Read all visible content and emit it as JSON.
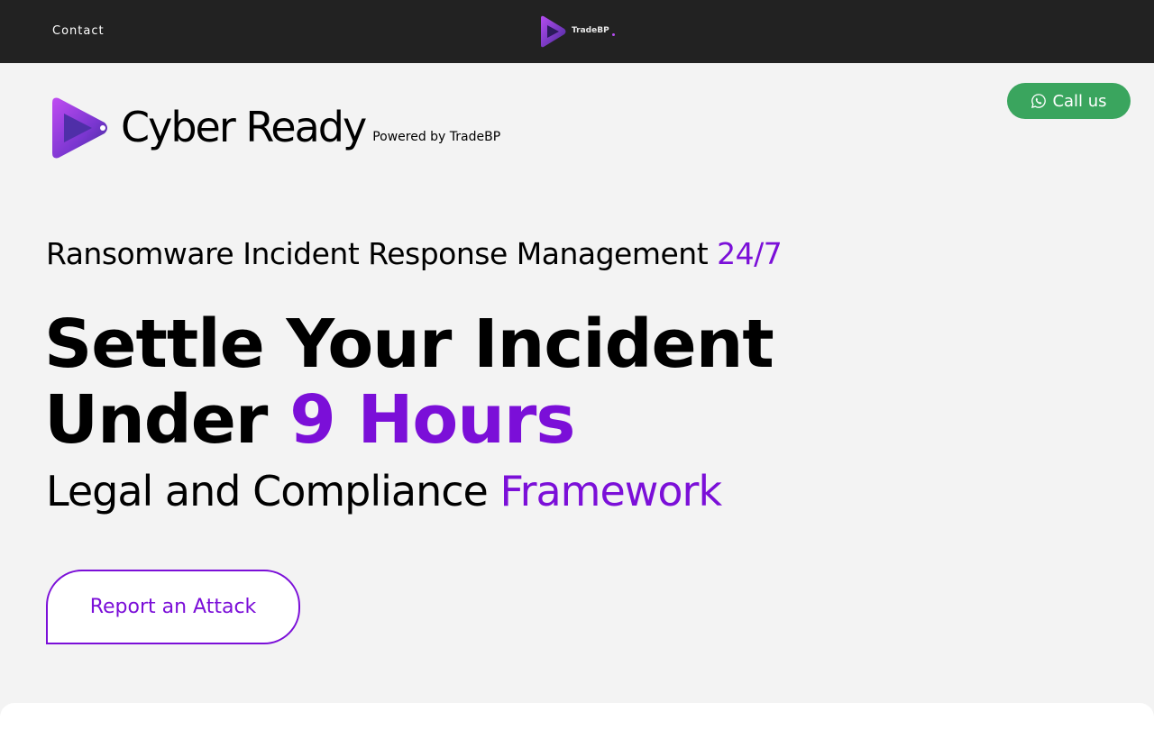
{
  "nav": {
    "contact_label": "Contact",
    "logo_text": "TradeBP"
  },
  "brand": {
    "name": "Cyber Ready",
    "powered_by": "Powered by TradeBP"
  },
  "call_button": {
    "label": "Call us",
    "icon": "whatsapp-icon",
    "color": "#3aa55e"
  },
  "hero": {
    "subheading_main": "Ransomware Incident Response Management ",
    "subheading_accent": "24/7",
    "title_line1": "Settle Your Incident",
    "title_line2_main": "Under ",
    "title_line2_accent": "9 Hours",
    "tagline_main": "Legal and Compliance ",
    "tagline_accent": "Framework",
    "accent_color": "#7b0fd8"
  },
  "report_button": {
    "label": "Report an Attack"
  }
}
